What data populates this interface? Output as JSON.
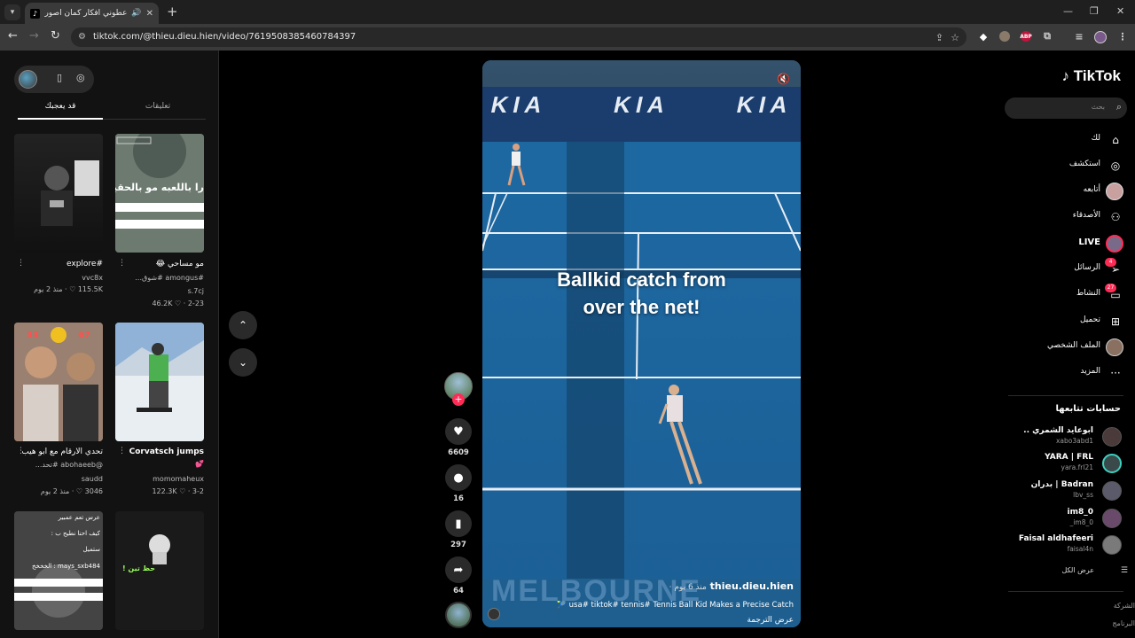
{
  "browser": {
    "tab_title": "عطوني افكار كمان اصورها و...",
    "url": "tiktok.com/@thieu.dieu.hien/video/7619508385460784397",
    "extensions": [
      "puzzle-icon",
      "ABP"
    ]
  },
  "left_panel": {
    "tabs": [
      "قد يعجبك",
      "تعليقات"
    ],
    "cards": [
      {
        "title": "#explore",
        "sub": "vvc8x",
        "meta": "115.5K ♡ · منذ 2 يوم"
      },
      {
        "title": "مو مساحي 😂",
        "sub": "#amongus #شوق...",
        "author": "s.7cj",
        "meta": "46.2K ♡ · 2-23"
      },
      {
        "title": "تحدي الارقام مع ابو هيب",
        "sub": "@abohaeeb #تحد...",
        "author": "saudd",
        "meta": "3046 ♡ · منذ 2 يوم"
      },
      {
        "title": "Corvatsch jumps",
        "sub": "",
        "author": "momomaheux",
        "meta": "122.3K ♡ · 3-2"
      }
    ],
    "thumb_texts": {
      "card2_overlay": "را باللعبه مو بالحقيقة",
      "card3_scores": [
        "33",
        "67"
      ],
      "card5_lines": [
        "عرس تعم عمبير",
        "كيف احنا نطيح ب :",
        "ستميل",
        "mays_sxb484 : الخخخخ",
        "حظ تين !"
      ]
    }
  },
  "video": {
    "caption_line1": "Ballkid catch from",
    "caption_line2": "over the net!",
    "author": "thieu.dieu.hien",
    "time": "منذ 6 يوم ·",
    "description": "usa# tiktok# tennis#  Tennis Ball Kid Makes a Precise Catch 🎾",
    "translate": "عرض الترجمة",
    "likes": "6609",
    "comments": "16",
    "saves": "297",
    "shares": "64",
    "sponsor_text": "KIA",
    "venue_text": "MELBOURNE"
  },
  "sidebar": {
    "logo": "TikTok",
    "search_placeholder": "بحث",
    "nav": [
      {
        "label": "لك",
        "icon": "home-icon"
      },
      {
        "label": "استكشف",
        "icon": "compass-icon"
      },
      {
        "label": "أتابعه",
        "icon": "following-icon"
      },
      {
        "label": "الأصدقاء",
        "icon": "friends-icon"
      },
      {
        "label": "LIVE",
        "icon": "live-icon"
      },
      {
        "label": "الرسائل",
        "icon": "messages-icon",
        "badge": "4"
      },
      {
        "label": "النشاط",
        "icon": "activity-icon",
        "badge": "27"
      },
      {
        "label": "تحميل",
        "icon": "upload-icon"
      },
      {
        "label": "الملف الشخصي",
        "icon": "profile-icon"
      },
      {
        "label": "المزيد",
        "icon": "more-icon"
      }
    ],
    "following_heading": "حسابات تتابعها",
    "accounts": [
      {
        "name": "ابوعايد الشمري ..",
        "handle": "xabo3abd1"
      },
      {
        "name": "YARA | FRL",
        "handle": "yara.frl21"
      },
      {
        "name": "Badran | بدران",
        "handle": "lbv_ss"
      },
      {
        "name": "im8_0",
        "handle": "_im8_0"
      },
      {
        "name": "Faisal aldhafeeri",
        "handle": "faisal4n"
      }
    ],
    "show_all": "عرض الكل",
    "footer": [
      "الشركة",
      "البرنامج"
    ]
  }
}
